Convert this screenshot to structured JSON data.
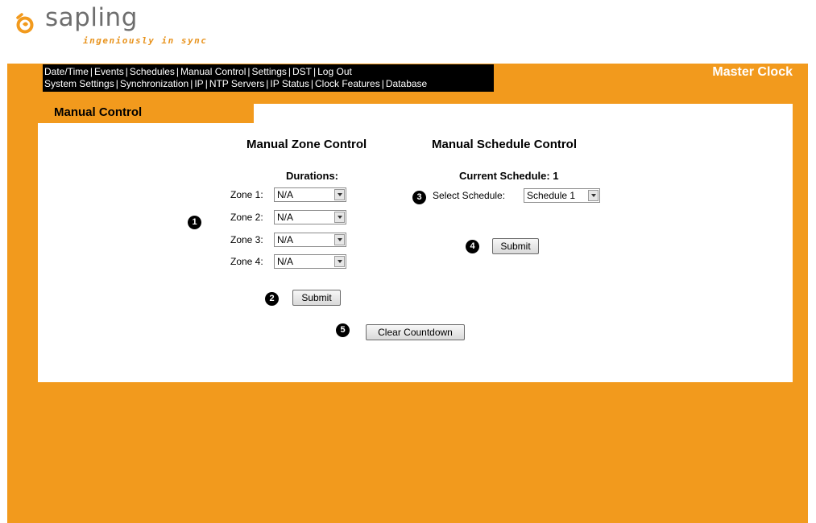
{
  "brand": {
    "logo_word": "sapling",
    "tagline": "ingeniously in sync",
    "product": "Master Clock"
  },
  "nav": {
    "row1": [
      "Date/Time",
      "Events",
      "Schedules",
      "Manual Control",
      "Settings",
      "DST",
      "Log Out"
    ],
    "row2": [
      "System Settings",
      "Synchronization",
      "IP",
      "NTP Servers",
      "IP Status",
      "Clock Features",
      "Database"
    ]
  },
  "page": {
    "title": "Manual Control"
  },
  "zone_control": {
    "heading": "Manual Zone Control",
    "durations_label": "Durations:",
    "zones": [
      {
        "label": "Zone 1:",
        "value": "N/A"
      },
      {
        "label": "Zone 2:",
        "value": "N/A"
      },
      {
        "label": "Zone 3:",
        "value": "N/A"
      },
      {
        "label": "Zone 4:",
        "value": "N/A"
      }
    ],
    "submit_label": "Submit"
  },
  "schedule_control": {
    "heading": "Manual Schedule Control",
    "current_schedule": "Current Schedule: 1",
    "select_label": "Select Schedule:",
    "select_value": "Schedule 1",
    "submit_label": "Submit"
  },
  "clear_countdown_label": "Clear Countdown",
  "markers": [
    "1",
    "2",
    "3",
    "4",
    "5"
  ],
  "colors": {
    "accent": "#f29a1d",
    "nav_bg": "#000000"
  }
}
